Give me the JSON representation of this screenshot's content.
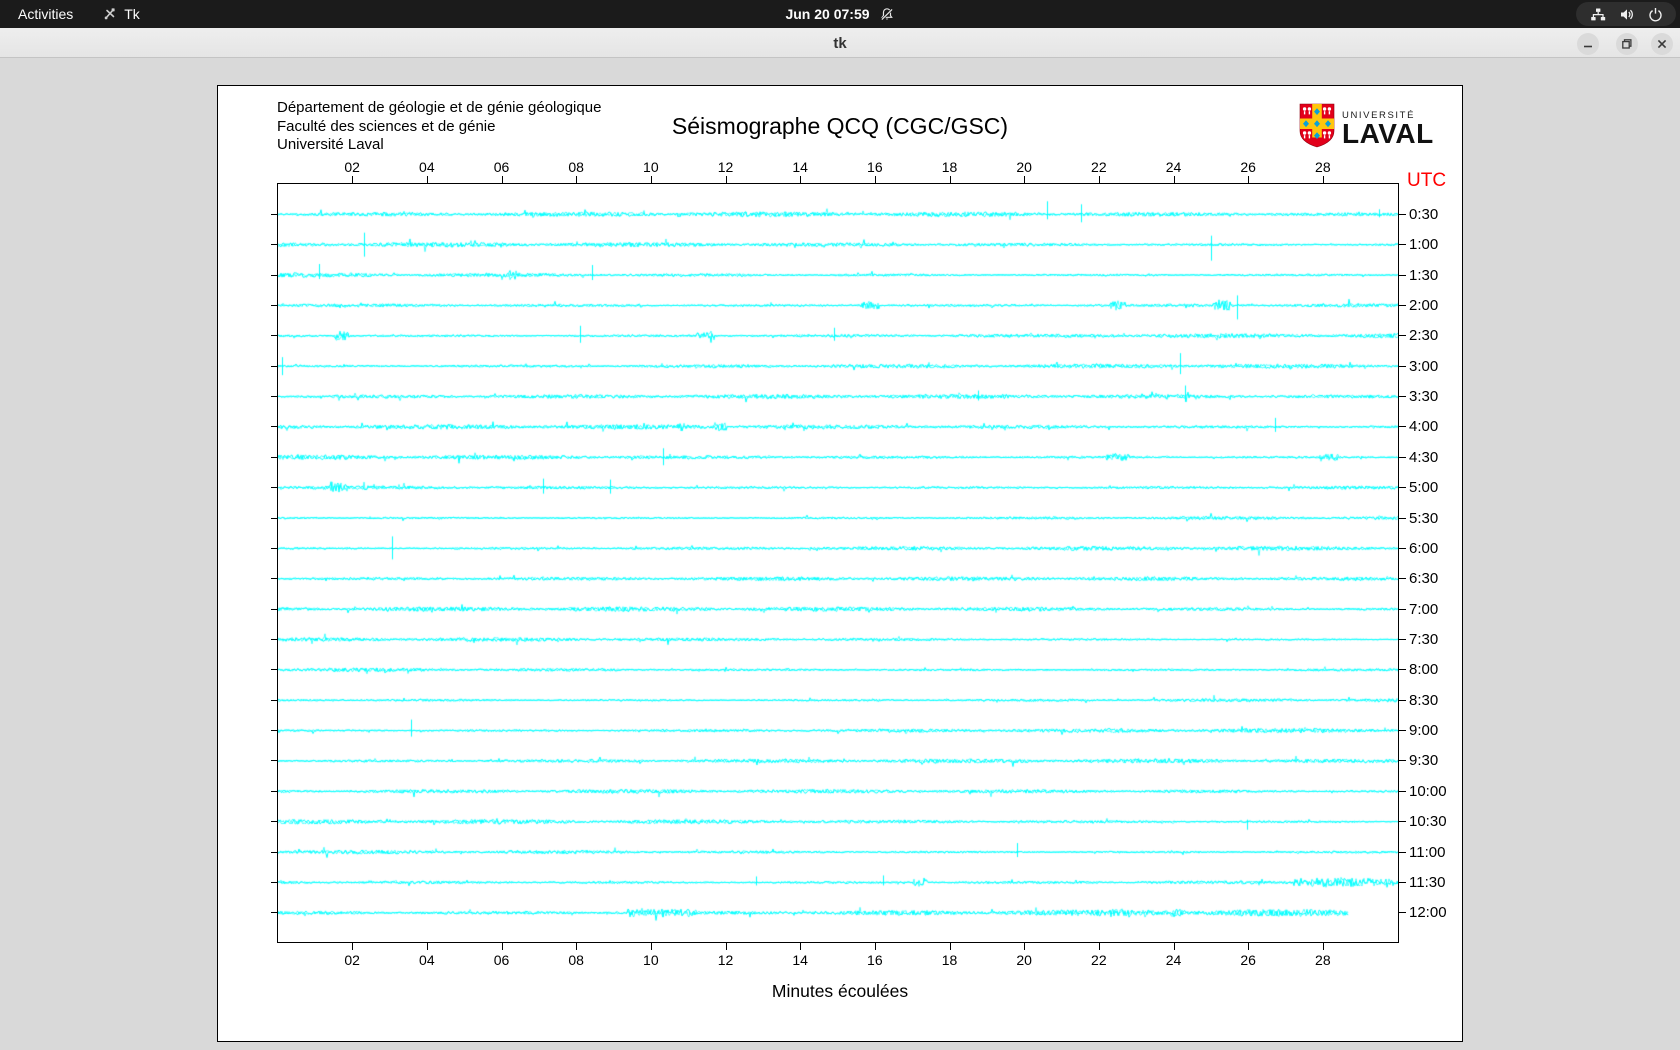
{
  "topbar": {
    "activities": "Activities",
    "app_menu": "Tk",
    "clock": "Jun 20  07:59"
  },
  "titlebar": {
    "title": "tk",
    "buttons": [
      "minimize",
      "maximize",
      "close"
    ]
  },
  "seismograph": {
    "institution_lines": [
      "Département de géologie et de génie géologique",
      "Faculté des sciences et de génie",
      "Université Laval"
    ],
    "title": "Séismographe QCQ (CGC/GSC)",
    "utc_label": "UTC",
    "x_axis_label": "Minutes écoulées",
    "logo": {
      "top": "UNIVERSITÉ",
      "bottom": "LAVAL"
    }
  },
  "colors": {
    "trace": "#00FFFF",
    "utc_label": "#FF0000",
    "paper": "#FFFFFF",
    "window_bg": "#D9D9D9",
    "logo_red": "#E2001A",
    "logo_gold": "#FFC60C",
    "logo_blue": "#0AA1D8"
  },
  "chart_data": {
    "type": "line",
    "subtype": "helicorder-seismogram",
    "title": "Séismographe QCQ (CGC/GSC)",
    "xlabel": "Minutes écoulées",
    "x_range_minutes": [
      0,
      30
    ],
    "x_ticks": [
      "02",
      "04",
      "06",
      "08",
      "10",
      "12",
      "14",
      "16",
      "18",
      "20",
      "22",
      "24",
      "26",
      "28"
    ],
    "y_axis_side": "right",
    "grid": false,
    "trace_color": "#00FFFF",
    "rows": [
      {
        "label": "0:30",
        "amp": 1.7,
        "end": 30,
        "spikes": [
          {
            "m": 20.6,
            "u": 13,
            "d": 5
          },
          {
            "m": 21.5,
            "u": 10,
            "d": 8
          },
          {
            "m": 29.5,
            "u": 5,
            "d": 3
          }
        ],
        "bursts": []
      },
      {
        "label": "1:00",
        "amp": 1.6,
        "end": 30,
        "spikes": [
          {
            "m": 2.3,
            "u": 12,
            "d": 12
          },
          {
            "m": 25.0,
            "u": 9,
            "d": 16
          }
        ],
        "bursts": []
      },
      {
        "label": "1:30",
        "amp": 1.5,
        "end": 30,
        "spikes": [
          {
            "m": 1.1,
            "u": 11,
            "d": 4
          },
          {
            "m": 8.4,
            "u": 10,
            "d": 5
          }
        ],
        "bursts": [
          {
            "m0": 6.0,
            "m1": 6.4,
            "a": 4.5
          }
        ]
      },
      {
        "label": "2:00",
        "amp": 1.7,
        "end": 30,
        "spikes": [
          {
            "m": 25.7,
            "u": 10,
            "d": 14
          }
        ],
        "bursts": [
          {
            "m0": 15.6,
            "m1": 16.1,
            "a": 4
          },
          {
            "m0": 22.3,
            "m1": 22.7,
            "a": 4.2
          },
          {
            "m0": 25.0,
            "m1": 25.5,
            "a": 4.5
          }
        ]
      },
      {
        "label": "2:30",
        "amp": 1.7,
        "end": 30,
        "spikes": [
          {
            "m": 8.1,
            "u": 10,
            "d": 7
          },
          {
            "m": 14.9,
            "u": 8,
            "d": 5
          }
        ],
        "bursts": [
          {
            "m0": 1.5,
            "m1": 1.95,
            "a": 4.5
          },
          {
            "m0": 11.2,
            "m1": 11.7,
            "a": 4
          }
        ]
      },
      {
        "label": "3:00",
        "amp": 1.5,
        "end": 30,
        "spikes": [
          {
            "m": 0.12,
            "u": 9,
            "d": 9
          },
          {
            "m": 24.15,
            "u": 13,
            "d": 8
          }
        ],
        "bursts": []
      },
      {
        "label": "3:30",
        "amp": 1.5,
        "end": 30,
        "spikes": [
          {
            "m": 18.75,
            "u": 6,
            "d": 4
          },
          {
            "m": 24.3,
            "u": 11,
            "d": 5
          }
        ],
        "bursts": []
      },
      {
        "label": "4:00",
        "amp": 1.6,
        "end": 30,
        "spikes": [
          {
            "m": 26.7,
            "u": 9,
            "d": 5
          }
        ],
        "bursts": [
          {
            "m0": 10.55,
            "m1": 10.9,
            "a": 4
          },
          {
            "m0": 11.7,
            "m1": 12.0,
            "a": 3.5
          }
        ]
      },
      {
        "label": "4:30",
        "amp": 1.6,
        "end": 30,
        "spikes": [
          {
            "m": 10.3,
            "u": 9,
            "d": 8
          }
        ],
        "bursts": [
          {
            "m0": 22.2,
            "m1": 22.8,
            "a": 3.5
          },
          {
            "m0": 27.9,
            "m1": 28.4,
            "a": 3.5
          }
        ]
      },
      {
        "label": "5:00",
        "amp": 1.7,
        "end": 30,
        "spikes": [
          {
            "m": 7.1,
            "u": 9,
            "d": 6
          },
          {
            "m": 8.9,
            "u": 8,
            "d": 6
          }
        ],
        "bursts": [
          {
            "m0": 1.4,
            "m1": 1.85,
            "a": 5
          }
        ]
      },
      {
        "label": "5:30",
        "amp": 1.3,
        "end": 30,
        "spikes": [],
        "bursts": []
      },
      {
        "label": "6:00",
        "amp": 1.5,
        "end": 30,
        "spikes": [
          {
            "m": 3.05,
            "u": 12,
            "d": 11
          }
        ],
        "bursts": []
      },
      {
        "label": "6:30",
        "amp": 1.4,
        "end": 30,
        "spikes": [],
        "bursts": []
      },
      {
        "label": "7:00",
        "amp": 1.6,
        "end": 30,
        "spikes": [],
        "bursts": []
      },
      {
        "label": "7:30",
        "amp": 1.35,
        "end": 30,
        "spikes": [],
        "bursts": []
      },
      {
        "label": "8:00",
        "amp": 1.5,
        "end": 30,
        "spikes": [],
        "bursts": []
      },
      {
        "label": "8:30",
        "amp": 1.4,
        "end": 30,
        "spikes": [],
        "bursts": []
      },
      {
        "label": "9:00",
        "amp": 1.5,
        "end": 30,
        "spikes": [
          {
            "m": 3.55,
            "u": 11,
            "d": 6
          }
        ],
        "bursts": []
      },
      {
        "label": "9:30",
        "amp": 1.45,
        "end": 30,
        "spikes": [],
        "bursts": []
      },
      {
        "label": "10:00",
        "amp": 1.35,
        "end": 30,
        "spikes": [],
        "bursts": []
      },
      {
        "label": "10:30",
        "amp": 1.55,
        "end": 30,
        "spikes": [
          {
            "m": 25.95,
            "u": 2,
            "d": 8
          }
        ],
        "bursts": []
      },
      {
        "label": "11:00",
        "amp": 1.5,
        "end": 30,
        "spikes": [
          {
            "m": 19.8,
            "u": 9,
            "d": 5
          }
        ],
        "bursts": []
      },
      {
        "label": "11:30",
        "amp": 1.6,
        "end": 30,
        "spikes": [
          {
            "m": 12.8,
            "u": 6,
            "d": 3
          },
          {
            "m": 16.2,
            "u": 7,
            "d": 3
          }
        ],
        "bursts": [
          {
            "m0": 17.0,
            "m1": 17.4,
            "a": 3.5
          },
          {
            "m0": 27.2,
            "m1": 29.8,
            "a": 4.2
          }
        ]
      },
      {
        "label": "12:00",
        "amp": 2.5,
        "end": 28.65,
        "spikes": [],
        "bursts": [
          {
            "m0": 9.3,
            "m1": 11.2,
            "a": 3.6
          },
          {
            "m0": 22.3,
            "m1": 22.8,
            "a": 4.2
          },
          {
            "m0": 23.9,
            "m1": 24.3,
            "a": 4
          }
        ]
      }
    ]
  }
}
